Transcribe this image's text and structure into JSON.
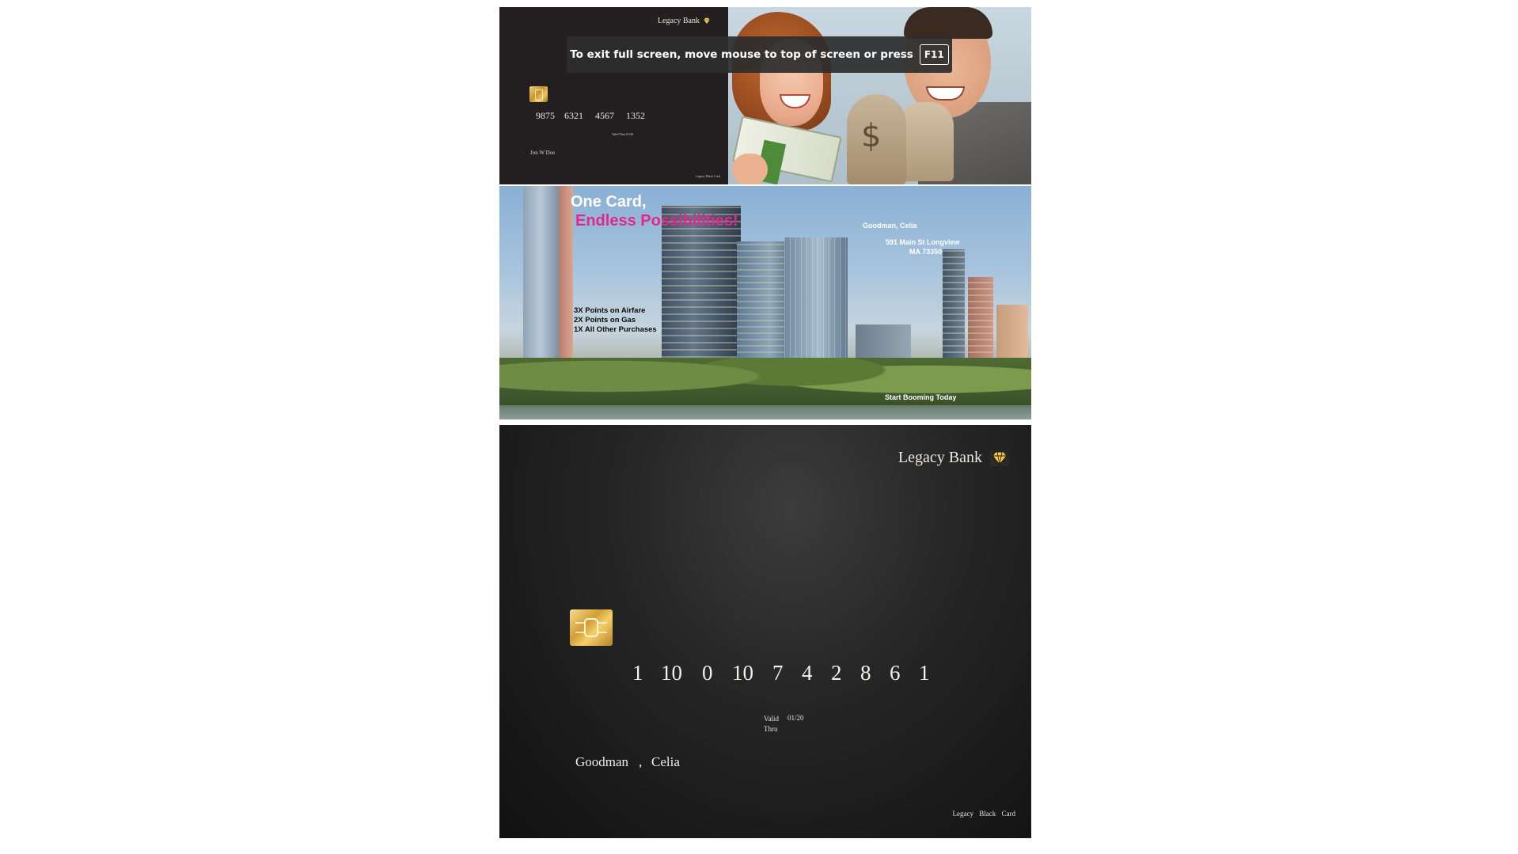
{
  "fullscreen_notice": {
    "message": "To exit full screen, move mouse to top of screen or press",
    "key": "F11"
  },
  "small_card": {
    "bank_name": "Legacy Bank",
    "number_groups": [
      "9875",
      "6321",
      "4567",
      "1352"
    ],
    "valid_label": "Valid Thru",
    "valid_date": "01/20",
    "cardholder": "Jon W Doe",
    "brand": "Legacy Black Card"
  },
  "banner": {
    "headline_1": "One Card,",
    "headline_2": "Endless Possibilities!",
    "recipient_name": "Goodman, Celia",
    "address_line_1": "591 Main St Longview",
    "address_line_2": "MA 73350",
    "points": [
      "3X Points on Airfare",
      "2X Points on Gas",
      "1X All Other Purchases"
    ],
    "cta": "Start Booming Today"
  },
  "large_card": {
    "bank_name": "Legacy Bank",
    "number_parts": [
      "1",
      "10",
      "0",
      "10",
      "7",
      "4",
      "2",
      "8",
      "6",
      "1"
    ],
    "valid_label_1": "Valid",
    "valid_label_2": "Thru",
    "valid_date": "01/20",
    "last_name": "Goodman",
    "comma": ",",
    "first_name": "Celia",
    "brand": "Legacy Black Card"
  },
  "colors": {
    "card_black": "#231f20",
    "headline_pink": "#e0288f",
    "gem_gold": "#f2c94c"
  }
}
